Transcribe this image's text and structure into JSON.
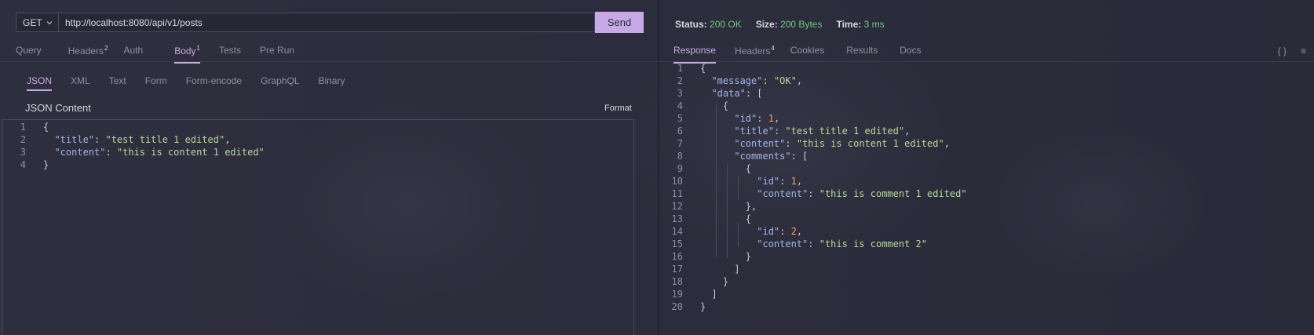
{
  "request": {
    "method": "GET",
    "url": "http://localhost:8080/api/v1/posts",
    "send_label": "Send",
    "tabs": [
      {
        "label": "Query",
        "badge": ""
      },
      {
        "label": "Headers",
        "badge": "2"
      },
      {
        "label": "Auth",
        "badge": ""
      },
      {
        "label": "Body",
        "badge": "1"
      },
      {
        "label": "Tests",
        "badge": ""
      },
      {
        "label": "Pre Run",
        "badge": ""
      }
    ],
    "body_types": [
      "JSON",
      "XML",
      "Text",
      "Form",
      "Form-encode",
      "GraphQL",
      "Binary"
    ],
    "content_label": "JSON Content",
    "format_label": "Format",
    "body_lines": [
      "1",
      "2",
      "3",
      "4"
    ]
  },
  "response": {
    "status_label": "Status:",
    "status_value": "200 OK",
    "size_label": "Size:",
    "size_value": "200 Bytes",
    "time_label": "Time:",
    "time_value": "3 ms",
    "tabs": [
      {
        "label": "Response",
        "badge": ""
      },
      {
        "label": "Headers",
        "badge": "4"
      },
      {
        "label": "Cookies",
        "badge": ""
      },
      {
        "label": "Results",
        "badge": ""
      },
      {
        "label": "Docs",
        "badge": ""
      }
    ],
    "icons": {
      "braces": "{ }",
      "menu": "≡"
    },
    "line_numbers": [
      "1",
      "2",
      "3",
      "4",
      "5",
      "6",
      "7",
      "8",
      "9",
      "10",
      "11",
      "12",
      "13",
      "14",
      "15",
      "16",
      "17",
      "18",
      "19",
      "20"
    ]
  },
  "colors": {
    "accent": "#c7a9e6",
    "status_ok": "#6ec77d",
    "json_key": "#9fb4e8",
    "json_string": "#b7d99a",
    "json_number": "#f0a36c"
  }
}
